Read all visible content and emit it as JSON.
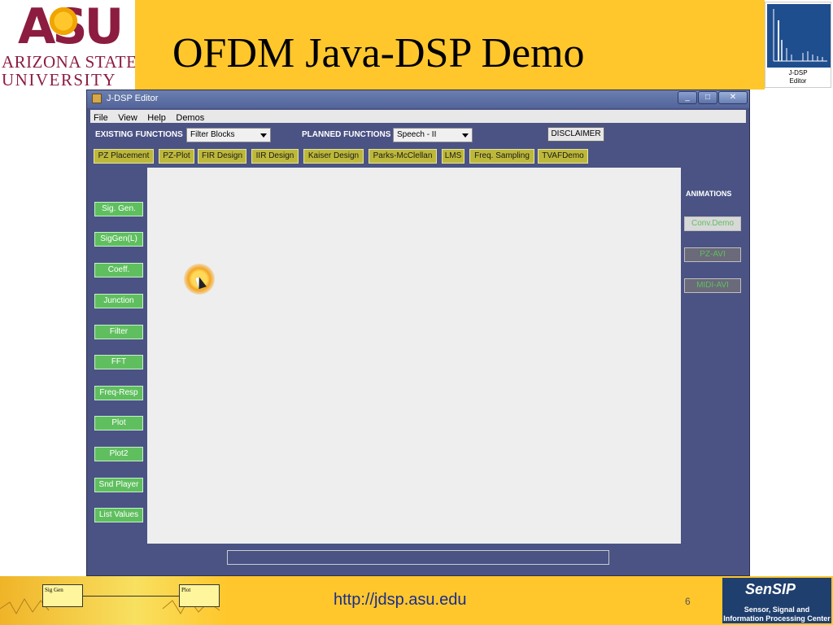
{
  "header": {
    "asu_mark": "ASU",
    "asu_line1": "ARIZONA STATE",
    "asu_line2": "UNIVERSITY",
    "slide_title": "OFDM Java-DSP Demo",
    "jdsp_caption_line1": "J-DSP",
    "jdsp_caption_line2": "Editor"
  },
  "window": {
    "title": "J-DSP Editor",
    "min_label": "_",
    "max_label": "□",
    "close_label": "✕"
  },
  "menu": [
    "File",
    "View",
    "Help",
    "Demos"
  ],
  "toolbar": {
    "existing_label": "EXISTING FUNCTIONS",
    "existing_value": "Filter Blocks",
    "planned_label": "PLANNED FUNCTIONS",
    "planned_value": "Speech - II",
    "disclaimer": "DISCLAIMER"
  },
  "function_buttons": [
    "PZ Placement",
    "PZ-Plot",
    "FIR Design",
    "IIR Design",
    "Kaiser Design",
    "Parks-McClellan",
    "LMS",
    "Freq. Sampling",
    "TVAFDemo"
  ],
  "blocks": [
    "Sig. Gen.",
    "SigGen(L)",
    "Coeff.",
    "Junction",
    "Filter",
    "FFT",
    "Freq-Resp",
    "Plot",
    "Plot2",
    "Snd Player",
    "List Values"
  ],
  "animations": {
    "label": "ANIMATIONS",
    "items": [
      "Conv.Demo",
      "PZ-AVI",
      "MIDI-AVI"
    ]
  },
  "footer": {
    "url": "http://jdsp.asu.edu",
    "page": "6",
    "block_a": "Sig Gen",
    "block_b": "Plot",
    "sensip_title": "SenSIP",
    "sensip_line1": "Sensor, Signal and",
    "sensip_line2": "Information Processing Center"
  },
  "colors": {
    "asu_maroon": "#8c1d40",
    "asu_gold": "#ffc72c",
    "window_bg": "#4a5384",
    "block_green": "#5fbf5f",
    "function_yellow": "#bdb83a"
  }
}
